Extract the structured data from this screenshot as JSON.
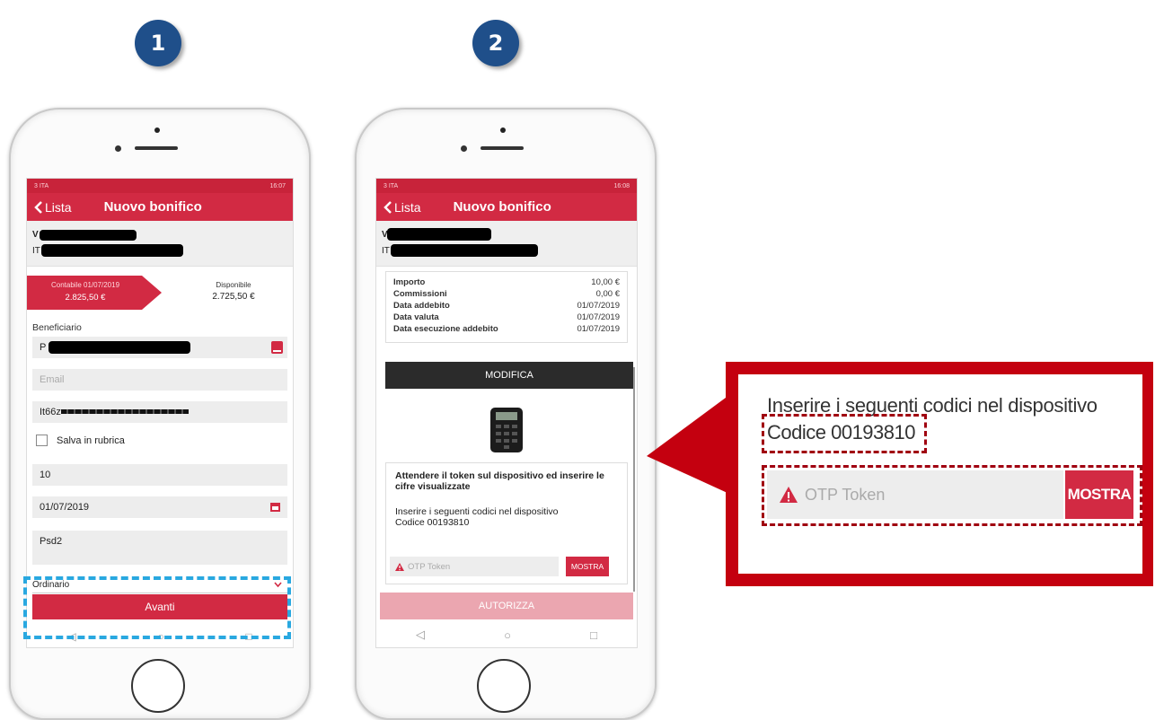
{
  "steps": {
    "one": "1",
    "two": "2"
  },
  "phone1": {
    "status_left": "3 ITA",
    "status_right": "16:07",
    "back_label": "Lista",
    "title": "Nuovo bonifico",
    "acct_line1": "V",
    "acct_line2": "IT",
    "contabile_label": "Contabile 01/07/2019",
    "contabile_value": "2.825,50 €",
    "disponibile_label": "Disponibile",
    "disponibile_value": "2.725,50 €",
    "beneficiario_label": "Beneficiario",
    "beneficiario_value": "P",
    "email_placeholder": "Email",
    "iban_value": "It66z",
    "salva_label": "Salva in rubrica",
    "importo_value": "10",
    "date_value": "01/07/2019",
    "causale_value": "Psd2",
    "tipo_value": "Ordinario",
    "avanti_label": "Avanti"
  },
  "phone2": {
    "status_left": "3 ITA",
    "status_right": "16:08",
    "back_label": "Lista",
    "title": "Nuovo bonifico",
    "acct_line1": "V",
    "acct_line2": "IT",
    "details": [
      {
        "label": "Importo",
        "value": "10,00 €"
      },
      {
        "label": "Commissioni",
        "value": "0,00 €"
      },
      {
        "label": "Data addebito",
        "value": "01/07/2019"
      },
      {
        "label": "Data valuta",
        "value": "01/07/2019"
      },
      {
        "label": "Data esecuzione addebito",
        "value": "01/07/2019"
      }
    ],
    "modifica_label": "MODIFICA",
    "wait_text": "Attendere il token sul dispositivo ed inserire le cifre visualizzate",
    "insert_text": "Inserire i seguenti codici nel dispositivo",
    "codice_text": "Codice 00193810",
    "otp_placeholder": "OTP Token",
    "mostra_label": "MOSTRA",
    "autorizza_label": "AUTORIZZA"
  },
  "callout": {
    "insert_text": "Inserire i seguenti codici nel dispositivo",
    "codice_text": "Codice 00193810",
    "otp_placeholder": "OTP Token",
    "mostra_label": "MOSTRA"
  },
  "colors": {
    "brand_red": "#d22a43",
    "callout_red": "#c4000f",
    "badge_blue": "#1f4f8a",
    "highlight_blue": "#29a8e0"
  }
}
